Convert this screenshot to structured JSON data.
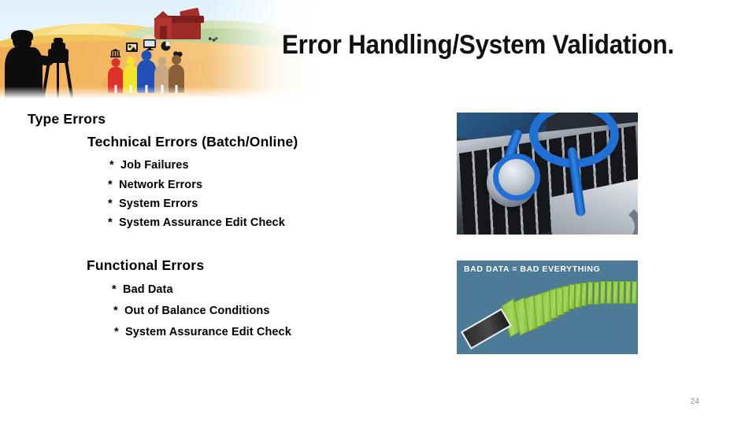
{
  "slide": {
    "title": "Error Handling/System Validation.",
    "page_number": "24",
    "background_color": "#ffffff"
  },
  "banner": {
    "name": "rural-farm-illustration-banner",
    "elements": {
      "photographer": "photographer-silhouette-with-tripod-camera",
      "barn": "red-barn-on-green-hill",
      "path": "winding-dirt-path",
      "cow": "small-cow-on-hillside",
      "people": [
        {
          "label": "person-red",
          "color": "#e0302a"
        },
        {
          "label": "person-yellow",
          "color": "#f5e32b"
        },
        {
          "label": "person-blue",
          "color": "#2050b8"
        },
        {
          "label": "person-tan",
          "color": "#c9a883"
        },
        {
          "label": "person-brown",
          "color": "#8a6038"
        }
      ],
      "icons": [
        "bank-icon",
        "picture-icon",
        "monitor-icon",
        "pie-chart-icon",
        "coins-icon"
      ]
    },
    "colors": {
      "sky": "#dff0fa",
      "hill_gold": "#f2c45c",
      "hill_orange": "#efa94b",
      "hill_green": "#b9d29c",
      "barn_red": "#9e2b28"
    }
  },
  "content": {
    "heading_1": "Type Errors",
    "heading_2": "Technical Errors  (Batch/Online)",
    "technical_bullets": [
      {
        "marker": "*",
        "text": "Job Failures"
      },
      {
        "marker": "*",
        "text": "Network Errors"
      },
      {
        "marker": "*",
        "text": "System Errors"
      },
      {
        "marker": "*",
        "text": "System Assurance Edit Check"
      }
    ],
    "heading_3": "Functional Errors",
    "functional_bullets": [
      {
        "marker": "*",
        "text": "Bad Data"
      },
      {
        "marker": "*",
        "text": "Out of Balance Conditions"
      },
      {
        "marker": "*",
        "text": "System Assurance Edit Check"
      }
    ]
  },
  "images": {
    "stethoscope": {
      "name": "stethoscope-on-laptop-keyboard-photo",
      "description": "blue stethoscope resting on a laptop keyboard",
      "accent_color": "#1f6fd4"
    },
    "dominoes": {
      "name": "falling-dominoes-graphic",
      "caption": "BAD DATA = BAD EVERYTHING",
      "background_color": "#4d7a96",
      "domino_color": "#8dc63f",
      "lead_domino_color": "#2b2b2b"
    }
  }
}
